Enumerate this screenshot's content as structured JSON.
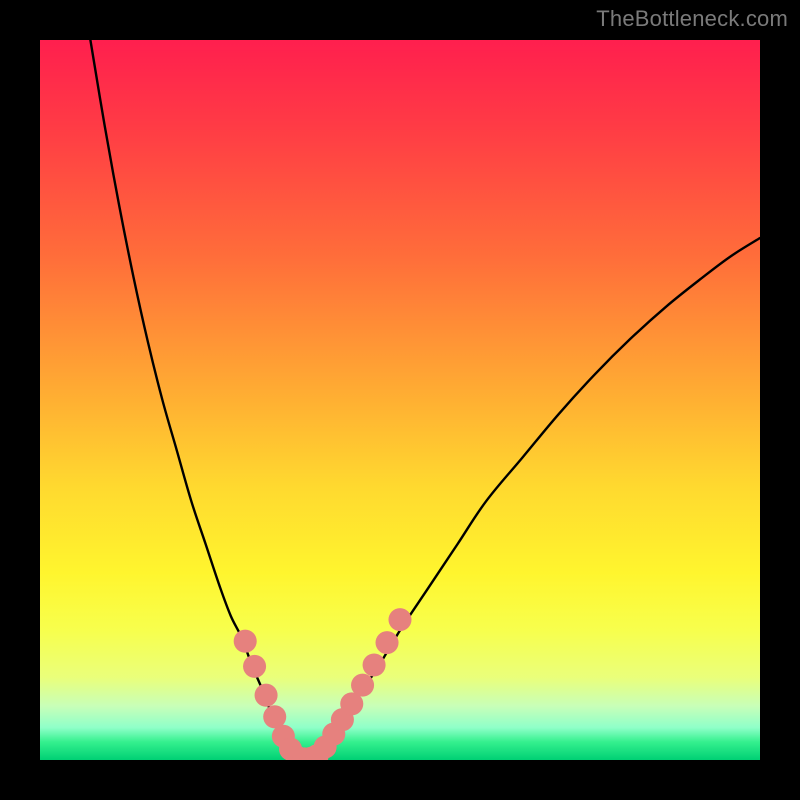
{
  "watermark": "TheBottleneck.com",
  "colors": {
    "bg": "#000000",
    "curve": "#000000",
    "dot_fill": "#e6817e",
    "dot_stroke": "#c05a56",
    "gradient_stops": [
      {
        "offset": 0.0,
        "color": "#ff1f4e"
      },
      {
        "offset": 0.12,
        "color": "#ff3b45"
      },
      {
        "offset": 0.3,
        "color": "#ff6d3a"
      },
      {
        "offset": 0.48,
        "color": "#ffa933"
      },
      {
        "offset": 0.62,
        "color": "#ffd92f"
      },
      {
        "offset": 0.74,
        "color": "#fff52e"
      },
      {
        "offset": 0.82,
        "color": "#f7ff4d"
      },
      {
        "offset": 0.885,
        "color": "#eaff7a"
      },
      {
        "offset": 0.925,
        "color": "#c8ffb8"
      },
      {
        "offset": 0.955,
        "color": "#8fffc9"
      },
      {
        "offset": 0.975,
        "color": "#34f08e"
      },
      {
        "offset": 1.0,
        "color": "#00d074"
      }
    ]
  },
  "chart_data": {
    "type": "line",
    "title": "",
    "xlabel": "",
    "ylabel": "",
    "xlim": [
      0,
      100
    ],
    "ylim": [
      0,
      100
    ],
    "grid": false,
    "series": [
      {
        "name": "left-curve",
        "x": [
          7,
          9,
          11,
          13,
          15,
          17,
          19,
          21,
          23,
          25,
          26.5,
          28,
          29.5,
          31,
          32,
          33,
          34,
          34.8,
          35.5
        ],
        "y": [
          100,
          88,
          77,
          67,
          58,
          50,
          43,
          36,
          30,
          24,
          20,
          17,
          13,
          9.5,
          6.8,
          4.5,
          2.7,
          1.3,
          0.5
        ]
      },
      {
        "name": "valley-floor",
        "x": [
          35.5,
          36.2,
          37,
          37.8,
          38.5
        ],
        "y": [
          0.5,
          0.2,
          0.1,
          0.2,
          0.5
        ]
      },
      {
        "name": "right-curve",
        "x": [
          38.5,
          40,
          42,
          44,
          47,
          50,
          54,
          58,
          62,
          67,
          72,
          77,
          82,
          87,
          92,
          96,
          100
        ],
        "y": [
          0.5,
          2.2,
          5,
          8.5,
          13,
          18,
          24,
          30,
          36,
          42,
          48,
          53.5,
          58.5,
          63,
          67,
          70,
          72.5
        ]
      }
    ],
    "annotations": {
      "dots_left": [
        {
          "x": 28.5,
          "y": 16.5
        },
        {
          "x": 29.8,
          "y": 13.0
        },
        {
          "x": 31.4,
          "y": 9.0
        },
        {
          "x": 32.6,
          "y": 6.0
        },
        {
          "x": 33.8,
          "y": 3.3
        },
        {
          "x": 34.8,
          "y": 1.5
        }
      ],
      "dots_floor": [
        {
          "x": 35.7,
          "y": 0.4
        },
        {
          "x": 36.7,
          "y": 0.15
        },
        {
          "x": 37.7,
          "y": 0.25
        },
        {
          "x": 38.5,
          "y": 0.6
        }
      ],
      "dots_right": [
        {
          "x": 39.6,
          "y": 1.8
        },
        {
          "x": 40.8,
          "y": 3.6
        },
        {
          "x": 42.0,
          "y": 5.6
        },
        {
          "x": 43.3,
          "y": 7.8
        },
        {
          "x": 44.8,
          "y": 10.4
        },
        {
          "x": 46.4,
          "y": 13.2
        },
        {
          "x": 48.2,
          "y": 16.3
        },
        {
          "x": 50.0,
          "y": 19.5
        }
      ],
      "dot_radius_percent": 1.6
    }
  }
}
